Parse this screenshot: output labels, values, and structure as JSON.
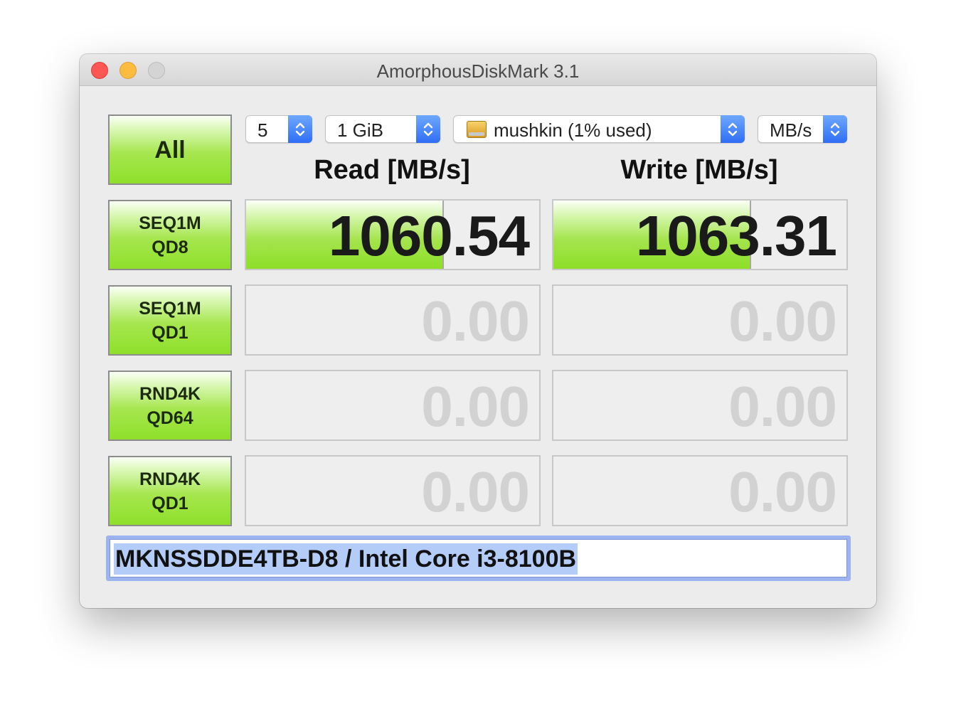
{
  "window": {
    "title": "AmorphousDiskMark 3.1"
  },
  "controls": {
    "all_label": "All",
    "count": "5",
    "size": "1 GiB",
    "drive": "mushkin (1% used)",
    "unit": "MB/s"
  },
  "columns": {
    "read_header": "Read [MB/s]",
    "write_header": "Write [MB/s]"
  },
  "tests": [
    {
      "line1": "SEQ1M",
      "line2": "QD8",
      "read": "1060.54",
      "write": "1063.31",
      "read_fill": 0.67,
      "write_fill": 0.67
    },
    {
      "line1": "SEQ1M",
      "line2": "QD1",
      "read": "0.00",
      "write": "0.00",
      "read_fill": 0,
      "write_fill": 0
    },
    {
      "line1": "RND4K",
      "line2": "QD64",
      "read": "0.00",
      "write": "0.00",
      "read_fill": 0,
      "write_fill": 0
    },
    {
      "line1": "RND4K",
      "line2": "QD1",
      "read": "0.00",
      "write": "0.00",
      "read_fill": 0,
      "write_fill": 0
    }
  ],
  "comment": "MKNSSDDE4TB-D8 / Intel Core i3-8100B",
  "colors": {
    "bar_green": "#8ddf28",
    "selection_blue": "#b4ccf8",
    "popup_arrow_blue": "#2f6ef5"
  },
  "icons": {
    "drive": "external-drive-icon",
    "popup_arrow": "up-down-chevron-icon"
  }
}
